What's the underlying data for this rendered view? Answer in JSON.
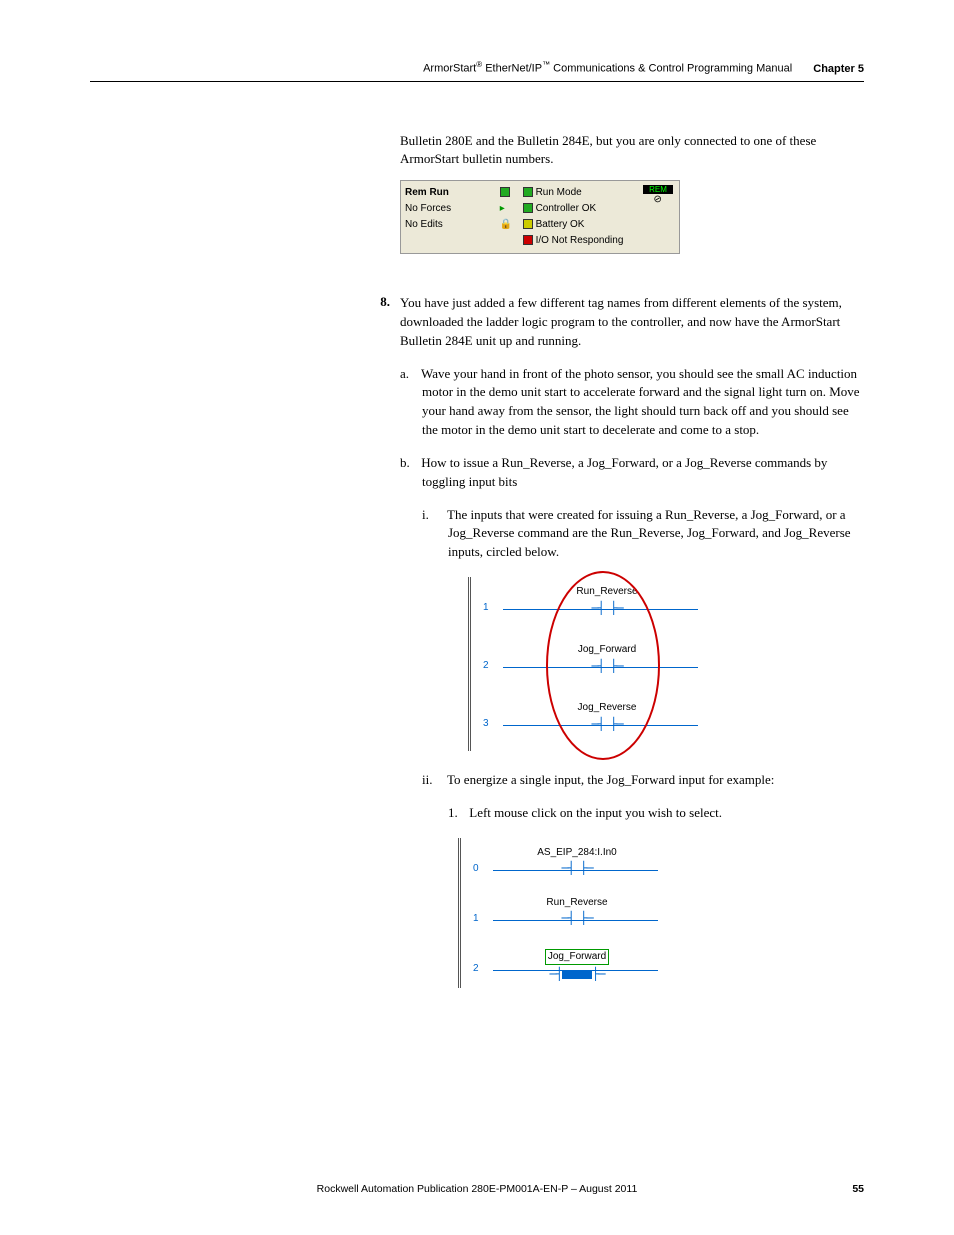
{
  "header": {
    "product": "ArmorStart",
    "reg": "®",
    "protocol": " EtherNet/IP",
    "tm": "™",
    "rest": " Communications & Control Programming Manual",
    "chapter": "Chapter 5"
  },
  "intro": "Bulletin 280E and the Bulletin 284E, but you are only connected to one of these ArmorStart bulletin numbers.",
  "status_panel": {
    "left": {
      "l1": "Rem Run",
      "l2": "No Forces",
      "l3": "No Edits"
    },
    "right": {
      "r1": "Run Mode",
      "r2": "Controller OK",
      "r3": "Battery OK",
      "r4": "I/O Not Responding"
    },
    "badge": "REM"
  },
  "step": {
    "num": "8.",
    "text": "You have just added a few different tag names from different elements of the system, downloaded the ladder logic program to the controller, and now have the ArmorStart Bulletin 284E unit up and running.",
    "a": {
      "label": "a.",
      "text": "Wave your hand in front of the photo sensor, you should see the small AC induction motor in the demo unit start to accelerate forward and the signal light turn on. Move your hand away from the sensor, the light should turn back off and you should see the motor in the demo unit start to decelerate and come to a stop."
    },
    "b": {
      "label": "b.",
      "text": "How to issue a Run_Reverse, a Jog_Forward, or a Jog_Reverse commands by toggling input bits",
      "i": {
        "label": "i.",
        "text": "The inputs that were created for issuing a Run_Reverse, a Jog_Forward, or a Jog_Reverse command are the Run_Reverse, Jog_Forward, and Jog_Reverse inputs, circled below."
      },
      "ii": {
        "label": "ii.",
        "text": "To energize a single input, the Jog_Forward input for example:",
        "one": {
          "label": "1.",
          "text": "Left mouse click on the input you wish to select."
        }
      }
    }
  },
  "ladder1": {
    "r1": {
      "num": "1",
      "label": "Run_Reverse"
    },
    "r2": {
      "num": "2",
      "label": "Jog_Forward"
    },
    "r3": {
      "num": "3",
      "label": "Jog_Reverse"
    }
  },
  "ladder2": {
    "r0": {
      "num": "0",
      "label": "AS_EIP_284:I.In0"
    },
    "r1": {
      "num": "1",
      "label": "Run_Reverse"
    },
    "r2": {
      "num": "2",
      "label": "Jog_Forward"
    }
  },
  "footer": {
    "text": "Rockwell Automation Publication 280E-PM001A-EN-P – August 2011",
    "page": "55"
  }
}
